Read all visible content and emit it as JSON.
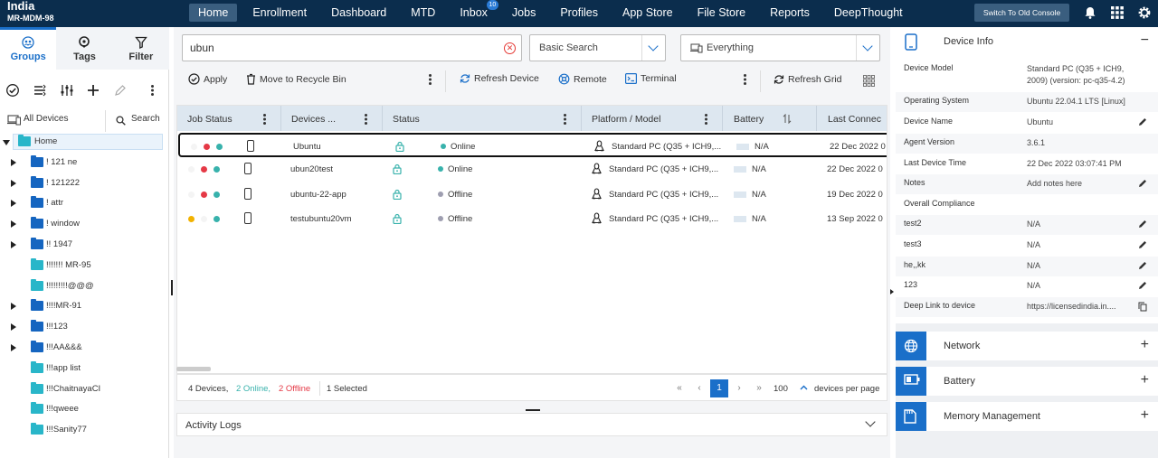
{
  "brand": {
    "region": "India",
    "account": "MR-MDM-98"
  },
  "nav": {
    "items": [
      {
        "label": "Home",
        "active": true
      },
      {
        "label": "Enrollment"
      },
      {
        "label": "Dashboard"
      },
      {
        "label": "MTD"
      },
      {
        "label": "Inbox",
        "badge": "10"
      },
      {
        "label": "Jobs"
      },
      {
        "label": "Profiles"
      },
      {
        "label": "App Store"
      },
      {
        "label": "File Store"
      },
      {
        "label": "Reports"
      },
      {
        "label": "DeepThought"
      }
    ],
    "old_console": "Switch To Old Console",
    "icons": [
      "bell-icon",
      "apps-grid-icon",
      "gear-icon"
    ]
  },
  "left": {
    "tabs": [
      {
        "label": "Groups",
        "icon": "groups-icon",
        "active": true
      },
      {
        "label": "Tags",
        "icon": "tag-icon"
      },
      {
        "label": "Filter",
        "icon": "filter-icon"
      }
    ],
    "all_devices": "All Devices",
    "search": "Search",
    "tree": [
      {
        "label": "Home",
        "root": true
      },
      {
        "label": "! 121 ne",
        "expandable": true
      },
      {
        "label": "! 121222",
        "expandable": true
      },
      {
        "label": "! attr",
        "expandable": true
      },
      {
        "label": "! window",
        "expandable": true
      },
      {
        "label": "!! 1947",
        "expandable": true
      },
      {
        "label": "!!!!!!! MR-95",
        "expandable": false
      },
      {
        "label": "!!!!!!!!!@@@",
        "expandable": false
      },
      {
        "label": "!!!!MR-91",
        "expandable": true
      },
      {
        "label": "!!!123",
        "expandable": true
      },
      {
        "label": "!!!AA&&&",
        "expandable": true
      },
      {
        "label": "!!!app list",
        "expandable": false
      },
      {
        "label": "!!!ChaitnayaCI",
        "expandable": false
      },
      {
        "label": "!!!qweee",
        "expandable": false
      },
      {
        "label": "!!!Sanity77",
        "expandable": false
      }
    ]
  },
  "search": {
    "value": "ubun",
    "mode": "Basic Search",
    "scope": "Everything"
  },
  "actions": {
    "apply": "Apply",
    "recycle": "Move to Recycle Bin",
    "refresh_device": "Refresh Device",
    "remote": "Remote",
    "terminal": "Terminal",
    "refresh_grid": "Refresh Grid"
  },
  "grid": {
    "columns": [
      "Job Status",
      "Devices ...",
      "Status",
      "Platform / Model",
      "Battery",
      "Last Connec"
    ],
    "rows": [
      {
        "name": "Ubuntu",
        "status": "Online",
        "platform": "Standard PC (Q35 + ICH9,...",
        "battery": "N/A",
        "last": "22 Dec 2022 0",
        "selected": true,
        "dots": [
          "#f4f4f4",
          "#e53946",
          "#38b2ac"
        ]
      },
      {
        "name": "ubun20test",
        "status": "Online",
        "platform": "Standard PC (Q35 + ICH9,...",
        "battery": "N/A",
        "last": "22 Dec 2022 0",
        "dots": [
          "#f4f4f4",
          "#e53946",
          "#38b2ac"
        ]
      },
      {
        "name": "ubuntu-22-app",
        "status": "Offline",
        "platform": "Standard PC (Q35 + ICH9,...",
        "battery": "N/A",
        "last": "19 Dec 2022 0",
        "dots": [
          "#f4f4f4",
          "#e53946",
          "#38b2ac"
        ]
      },
      {
        "name": "testubuntu20vm",
        "status": "Offline",
        "platform": "Standard PC (Q35 + ICH9,...",
        "battery": "N/A",
        "last": "13 Sep 2022 0",
        "dots": [
          "#f2b200",
          "#f4f4f4",
          "#38b2ac"
        ]
      }
    ]
  },
  "footer": {
    "total": "4 Devices,",
    "online": "2 Online,",
    "offline": "2 Offline",
    "selected": "1 Selected",
    "page": "1",
    "per_page_value": "100",
    "per_page_label": "devices per page"
  },
  "activity": {
    "title": "Activity Logs"
  },
  "device_info": {
    "title": "Device Info",
    "rows": [
      {
        "key": "Device Model",
        "value": "Standard PC (Q35 + ICH9, 2009) (version: pc-q35-4.2)"
      },
      {
        "key": "Operating System",
        "value": "Ubuntu 22.04.1 LTS [Linux]"
      },
      {
        "key": "Device Name",
        "value": "Ubuntu",
        "edit": true
      },
      {
        "key": "Agent Version",
        "value": "3.6.1"
      },
      {
        "key": "Last Device Time",
        "value": "22 Dec 2022 03:07:41 PM"
      },
      {
        "key": "Notes",
        "value": "Add notes here",
        "edit": true
      },
      {
        "key": "Overall Compliance",
        "value": ""
      },
      {
        "key": "test2",
        "value": "N/A",
        "edit": true
      },
      {
        "key": "test3",
        "value": "N/A",
        "edit": true
      },
      {
        "key": "he,,kk",
        "value": "N/A",
        "edit": true
      },
      {
        "key": "123",
        "value": "N/A",
        "edit": true
      },
      {
        "key": "Deep Link to device",
        "value": "https://licensedindia.in...."
      }
    ]
  },
  "panels": [
    {
      "title": "Network",
      "icon": "globe-icon"
    },
    {
      "title": "Battery",
      "icon": "battery-icon"
    },
    {
      "title": "Memory Management",
      "icon": "sd-card-icon"
    }
  ],
  "colors": {
    "accent": "#1a6fc9",
    "topbar": "#0b2d4d",
    "online": "#38b2ac",
    "offline": "#9e9eb0"
  }
}
